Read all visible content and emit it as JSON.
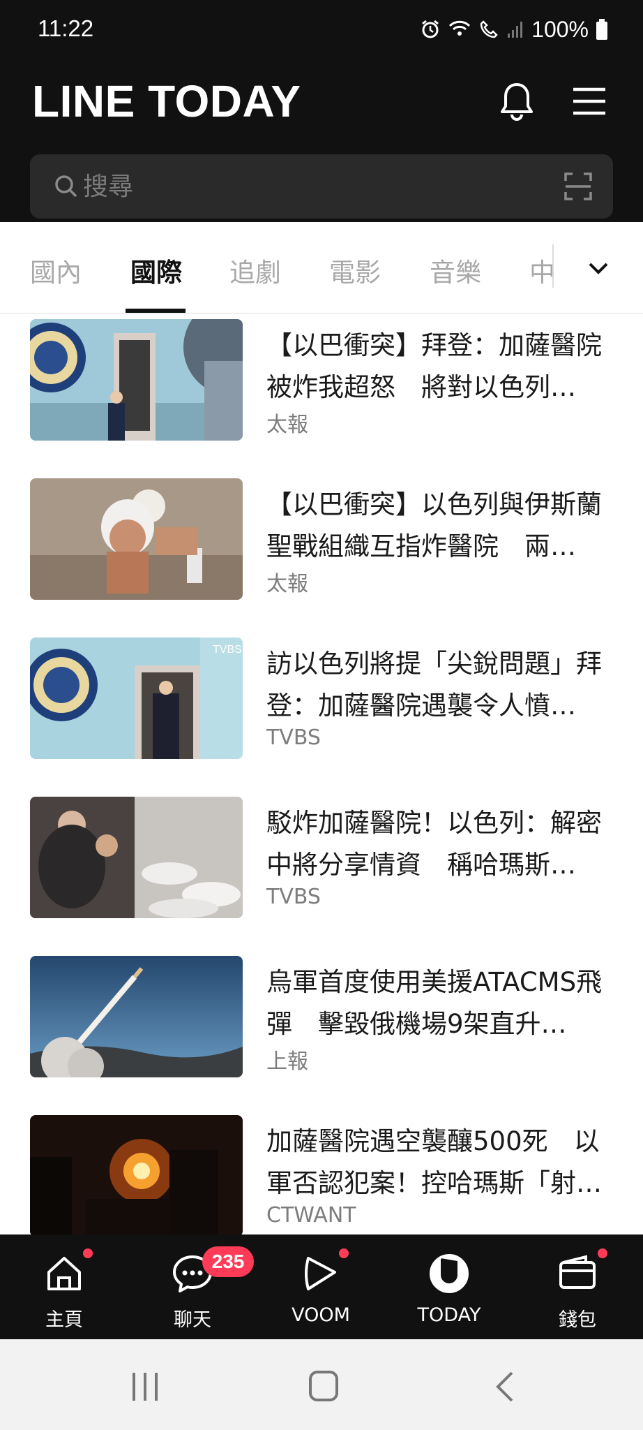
{
  "status": {
    "time": "11:22",
    "battery": "100%"
  },
  "header": {
    "brand": "LINE TODAY"
  },
  "search": {
    "placeholder": "搜尋"
  },
  "tabs": [
    {
      "label": "國內",
      "active": false
    },
    {
      "label": "國際",
      "active": true
    },
    {
      "label": "追劇",
      "active": false
    },
    {
      "label": "電影",
      "active": false
    },
    {
      "label": "音樂",
      "active": false
    },
    {
      "label": "中",
      "active": false
    }
  ],
  "articles": [
    {
      "headline": "【以巴衝突】拜登：加薩醫院被炸我超怒　將對以色列…",
      "source": "太報"
    },
    {
      "headline": "【以巴衝突】以色列與伊斯蘭聖戰組織互指炸醫院　兩…",
      "source": "太報"
    },
    {
      "headline": "訪以色列將提「尖銳問題」拜登：加薩醫院遇襲令人憤…",
      "source": "TVBS"
    },
    {
      "headline": "駁炸加薩醫院！以色列：解密中將分享情資　稱哈瑪斯…",
      "source": "TVBS"
    },
    {
      "headline": "烏軍首度使用美援ATACMS飛彈　擊毀俄機場9架直升…",
      "source": "上報"
    },
    {
      "headline": "加薩醫院遇空襲釀500死　以軍否認犯案！控哈瑪斯「射…",
      "source": "CTWANT"
    }
  ],
  "bottom_nav": [
    {
      "label": "主頁",
      "icon": "home-icon",
      "dot": true
    },
    {
      "label": "聊天",
      "icon": "chat-icon",
      "badge": "235"
    },
    {
      "label": "VOOM",
      "icon": "voom-icon",
      "dot": true
    },
    {
      "label": "TODAY",
      "icon": "today-icon"
    },
    {
      "label": "錢包",
      "icon": "wallet-icon",
      "dot": true
    }
  ],
  "colors": {
    "accent": "#ff3b58",
    "dark": "#111111"
  }
}
